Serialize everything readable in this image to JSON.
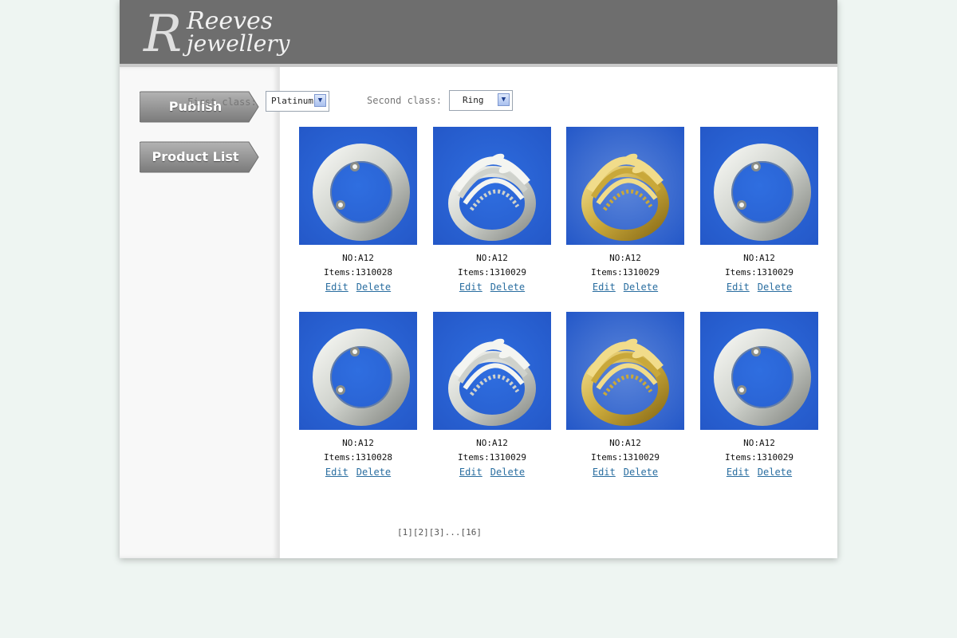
{
  "brand": {
    "logo_text_1": "Reeves",
    "logo_text_2": "jewellery"
  },
  "sidebar": {
    "items": [
      {
        "label": "Publish",
        "icon": "arrow-tab"
      },
      {
        "label": "Product List",
        "icon": "arrow-tab"
      }
    ]
  },
  "filters": {
    "first_class_label": "First class:",
    "first_class_value": "Platinum",
    "second_class_label": "Second class:",
    "second_class_value": "Ring"
  },
  "products": [
    {
      "no": "NO:A12",
      "items": "Items:1310028",
      "edit": "Edit",
      "delete": "Delete",
      "ring": "band-silver"
    },
    {
      "no": "NO:A12",
      "items": "Items:1310029",
      "edit": "Edit",
      "delete": "Delete",
      "ring": "leaf-silver"
    },
    {
      "no": "NO:A12",
      "items": "Items:1310029",
      "edit": "Edit",
      "delete": "Delete",
      "ring": "leaf-gold"
    },
    {
      "no": "NO:A12",
      "items": "Items:1310029",
      "edit": "Edit",
      "delete": "Delete",
      "ring": "band-silver"
    },
    {
      "no": "NO:A12",
      "items": "Items:1310028",
      "edit": "Edit",
      "delete": "Delete",
      "ring": "band-silver"
    },
    {
      "no": "NO:A12",
      "items": "Items:1310029",
      "edit": "Edit",
      "delete": "Delete",
      "ring": "leaf-silver"
    },
    {
      "no": "NO:A12",
      "items": "Items:1310029",
      "edit": "Edit",
      "delete": "Delete",
      "ring": "leaf-gold"
    },
    {
      "no": "NO:A12",
      "items": "Items:1310029",
      "edit": "Edit",
      "delete": "Delete",
      "ring": "band-silver"
    }
  ],
  "pager": {
    "text": "[1][2][3]...[16]"
  },
  "colors": {
    "photo_bg": "#2f6ee0",
    "photo_bg_gold": "#5c86da",
    "header": "#6e6e6e",
    "link": "#2a6ea0"
  }
}
